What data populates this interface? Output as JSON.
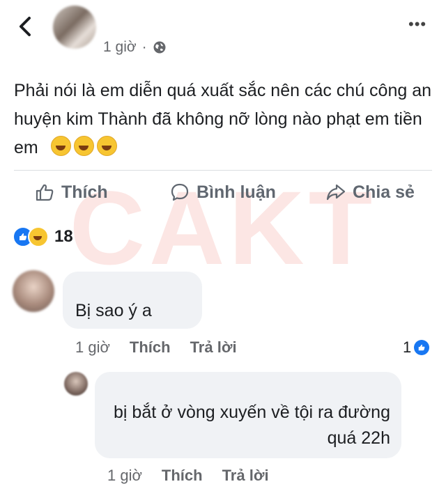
{
  "watermark": "CAKT",
  "post": {
    "time": "1 giờ",
    "separator": "·",
    "text": "Phải nói là em diễn quá xuất sắc nên các chú công an huyện kim Thành đã không nỡ lòng nào phạt em tiền em",
    "emoji_icons": [
      "rofl-emoji",
      "rofl-emoji",
      "rofl-emoji"
    ]
  },
  "actions": {
    "like": "Thích",
    "comment": "Bình luận",
    "share": "Chia sẻ"
  },
  "reactions": {
    "icons": [
      "like-reaction-icon",
      "haha-reaction-icon"
    ],
    "count": "18"
  },
  "comments": [
    {
      "text": "Bị sao ý a",
      "time": "1 giờ",
      "like_label": "Thích",
      "reply_label": "Trả lời",
      "like_count": "1"
    },
    {
      "text": "bị bắt ở vòng xuyến về tội ra đường quá 22h",
      "time": "1 giờ",
      "like_label": "Thích",
      "reply_label": "Trả lời"
    }
  ],
  "colors": {
    "accent": "#1877f2",
    "text": "#1c1e21",
    "muted": "#65676b",
    "bubble": "#f0f2f5",
    "watermark": "#eb3c32"
  }
}
